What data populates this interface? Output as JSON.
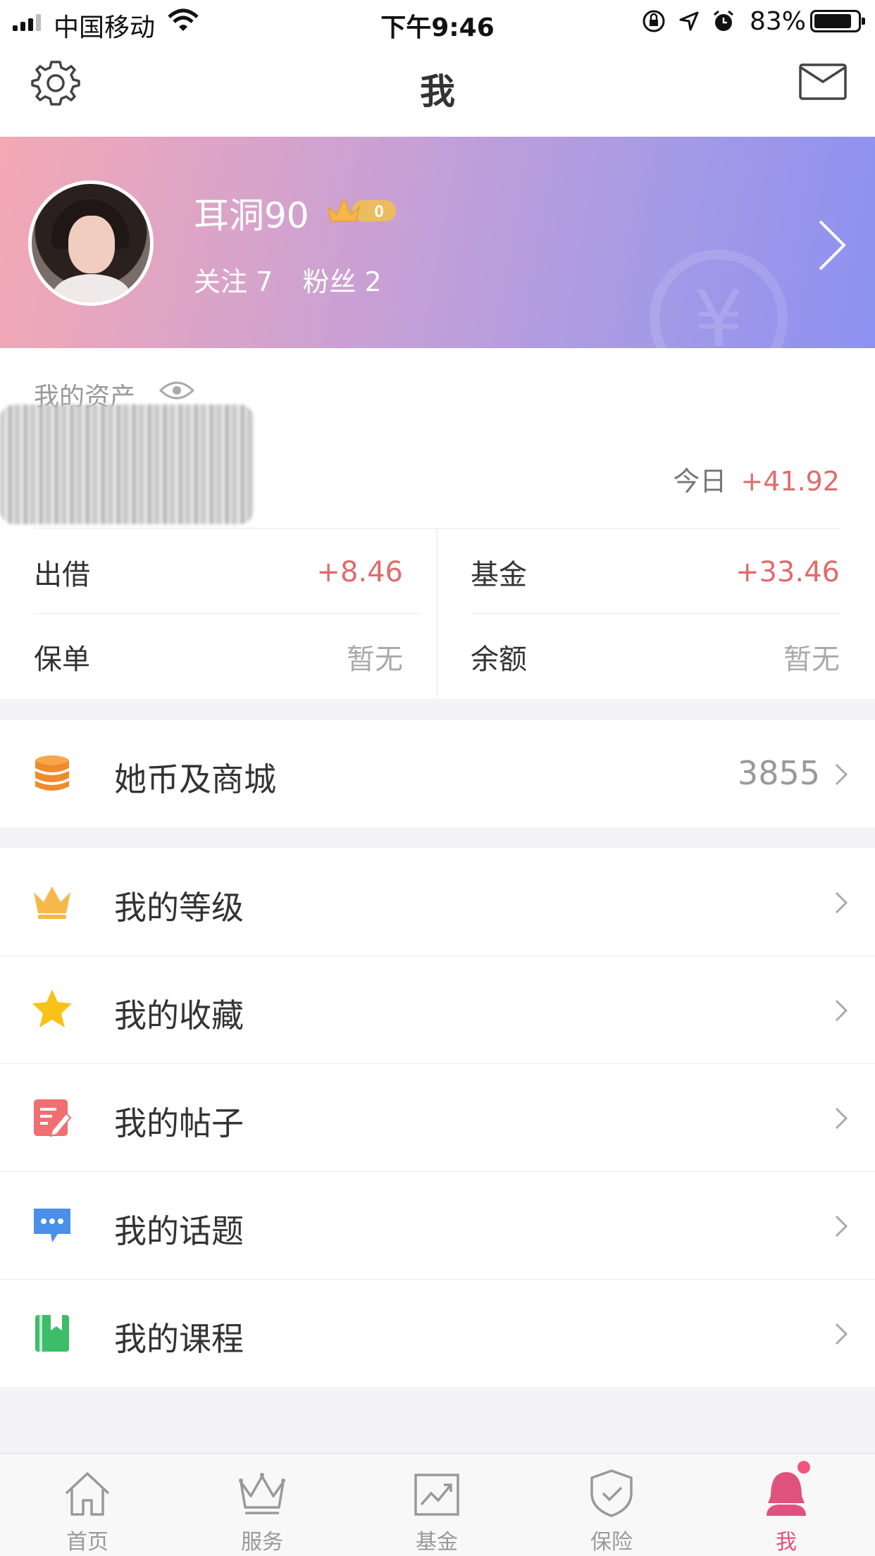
{
  "status_bar": {
    "carrier": "中国移动",
    "time": "下午9:46",
    "battery_percent": "83%",
    "icons": [
      "signal-icon",
      "wifi-icon",
      "orientation-lock-icon",
      "location-icon",
      "alarm-icon",
      "battery-icon"
    ]
  },
  "nav": {
    "title": "我",
    "left_icon": "settings-gear-icon",
    "right_icon": "mail-envelope-icon"
  },
  "profile": {
    "username": "耳洞90",
    "level_badge": "0",
    "following_label": "关注 7",
    "followers_label": "粉丝 2",
    "banner_watermark": "¥",
    "colors": {
      "gradient_start": "#f4a9b4",
      "gradient_end": "#8d91f1"
    }
  },
  "assets": {
    "title": "我的资产",
    "today_label": "今日",
    "today_value": "+41.92",
    "cells": [
      {
        "label": "出借",
        "value": "+8.46"
      },
      {
        "label": "基金",
        "value": "+33.46"
      },
      {
        "label": "保单",
        "value": "暂无"
      },
      {
        "label": "余额",
        "value": "暂无"
      }
    ],
    "colors": {
      "positive": "#e06c6c",
      "empty": "#aaaaaa"
    }
  },
  "coin_row": {
    "label": "她币及商城",
    "value": "3855",
    "icon": "coin-stack-icon"
  },
  "menu": [
    {
      "label": "我的等级",
      "icon": "crown-icon"
    },
    {
      "label": "我的收藏",
      "icon": "star-icon"
    },
    {
      "label": "我的帖子",
      "icon": "post-edit-icon"
    },
    {
      "label": "我的话题",
      "icon": "chat-bubble-icon"
    },
    {
      "label": "我的课程",
      "icon": "bookmark-book-icon"
    }
  ],
  "tabbar": {
    "tabs": [
      {
        "label": "首页",
        "icon": "home-icon"
      },
      {
        "label": "服务",
        "icon": "crown-outline-icon"
      },
      {
        "label": "基金",
        "icon": "chart-trend-icon"
      },
      {
        "label": "保险",
        "icon": "shield-check-icon"
      },
      {
        "label": "我",
        "icon": "user-profile-icon"
      }
    ],
    "active_index": 4,
    "active_color": "#e0527e"
  }
}
